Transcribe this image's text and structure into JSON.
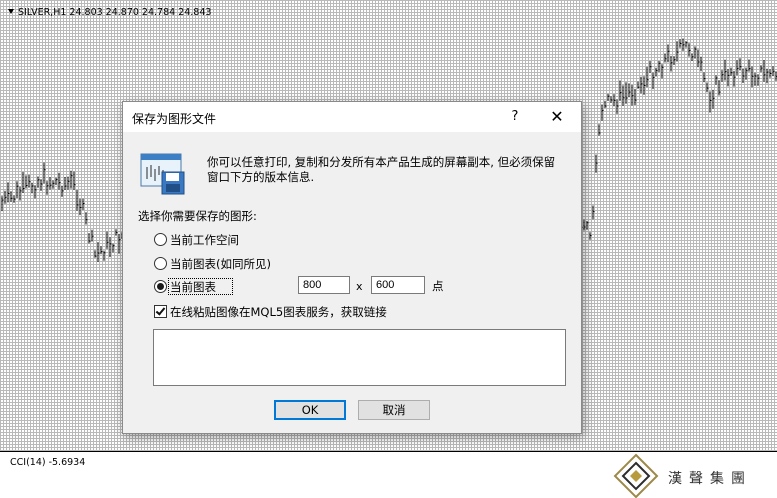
{
  "chart": {
    "header": "SILVER,H1  24.803 24.870 24.784 24.843",
    "indicator": "CCI(14) -5.6934"
  },
  "watermark": {
    "text": "漢聲集團"
  },
  "dialog": {
    "title": "保存为图形文件",
    "help_label": "?",
    "close_label": "✕",
    "description": "你可以任意打印, 复制和分发所有本产品生成的屏幕副本, 但必须保留窗口下方的版本信息.",
    "select_label": "选择你需要保存的图形:",
    "options": [
      {
        "label": "当前工作空间",
        "selected": false
      },
      {
        "label": "当前图表(如同所见)",
        "selected": false
      },
      {
        "label": "当前图表",
        "selected": true
      }
    ],
    "width_value": "800",
    "times_label": "x",
    "height_value": "600",
    "unit_label": "点",
    "upload_label": "在线粘贴图像在MQL5图表服务，获取链接",
    "upload_checked": true,
    "link_value": "",
    "ok_label": "OK",
    "cancel_label": "取消"
  },
  "icons": {
    "dialog_icon": "save-chart-icon",
    "close": "close-icon",
    "help": "help-icon",
    "logo": "company-logo-icon"
  }
}
